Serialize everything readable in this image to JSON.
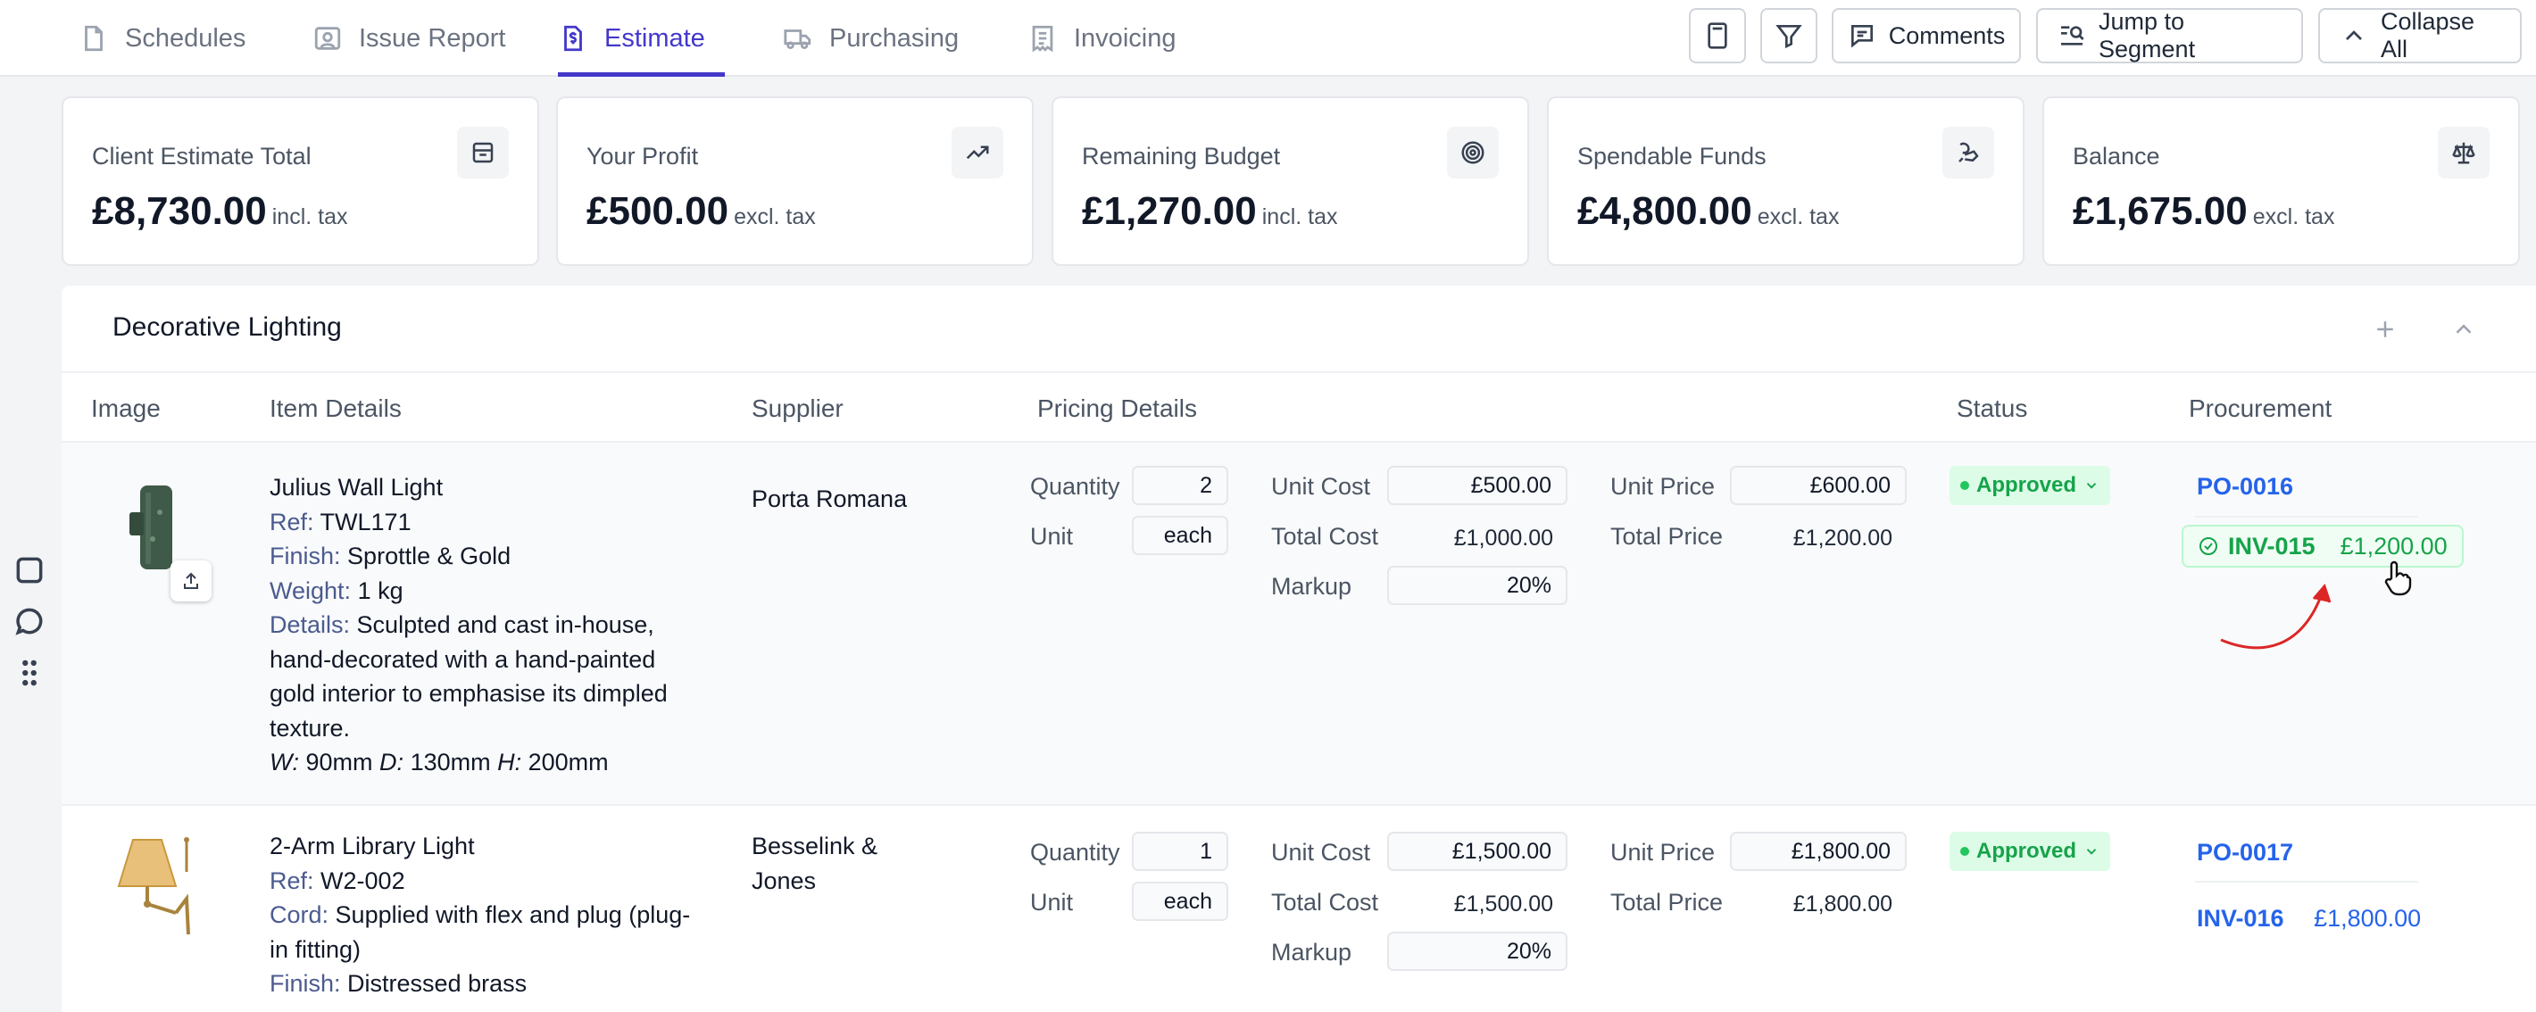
{
  "tabs": [
    {
      "label": "Schedules",
      "icon": "schedules-icon",
      "active": false
    },
    {
      "label": "Issue Report",
      "icon": "issue-report-icon",
      "active": false
    },
    {
      "label": "Estimate",
      "icon": "estimate-icon",
      "active": true
    },
    {
      "label": "Purchasing",
      "icon": "truck-icon",
      "active": false
    },
    {
      "label": "Invoicing",
      "icon": "invoice-icon",
      "active": false
    }
  ],
  "toolbar": {
    "comments_label": "Comments",
    "jump_label": "Jump to Segment",
    "collapse_label": "Collapse All"
  },
  "summary_cards": [
    {
      "label": "Client Estimate Total",
      "amount": "£8,730.00",
      "tax": "incl. tax",
      "icon": "inbox-icon"
    },
    {
      "label": "Your Profit",
      "amount": "£500.00",
      "tax": "excl. tax",
      "icon": "trending-up-icon"
    },
    {
      "label": "Remaining Budget",
      "amount": "£1,270.00",
      "tax": "incl. tax",
      "icon": "target-icon"
    },
    {
      "label": "Spendable Funds",
      "amount": "£4,800.00",
      "tax": "excl. tax",
      "icon": "coins-icon"
    },
    {
      "label": "Balance",
      "amount": "£1,675.00",
      "tax": "excl. tax",
      "icon": "scale-icon"
    }
  ],
  "section": {
    "title": "Decorative Lighting",
    "columns": [
      "Image",
      "Item Details",
      "Supplier",
      "Pricing Details",
      "Status",
      "Procurement"
    ]
  },
  "labels": {
    "ref": "Ref:",
    "finish": "Finish:",
    "weight": "Weight:",
    "details": "Details:",
    "cord": "Cord:",
    "w": "W:",
    "d": "D:",
    "h": "H:",
    "quantity": "Quantity",
    "unit": "Unit",
    "unit_cost": "Unit Cost",
    "total_cost": "Total Cost",
    "markup": "Markup",
    "unit_price": "Unit Price",
    "total_price": "Total Price",
    "percent": "%"
  },
  "items": [
    {
      "name": "Julius Wall Light",
      "ref": "TWL171",
      "finish": "Sprottle & Gold",
      "weight": "1 kg",
      "details": "Sculpted and cast in-house, hand-decorated with a hand-painted gold interior to emphasise its dimpled texture.",
      "w": "90mm",
      "d": "130mm",
      "h": "200mm",
      "supplier": "Porta Romana",
      "quantity": "2",
      "unit": "each",
      "unit_cost": "£500.00",
      "total_cost": "£1,000.00",
      "markup": "20",
      "unit_price": "£600.00",
      "total_price": "£1,200.00",
      "status": "Approved",
      "po": "PO-0016",
      "invoice": "INV-015",
      "invoice_amount": "£1,200.00"
    },
    {
      "name": "2-Arm Library Light",
      "ref": "W2-002",
      "cord": "Supplied with flex and plug (plug-in fitting)",
      "finish": "Distressed brass",
      "supplier": "Besselink & Jones",
      "quantity": "1",
      "unit": "each",
      "unit_cost": "£1,500.00",
      "total_cost": "£1,500.00",
      "markup": "20",
      "unit_price": "£1,800.00",
      "total_price": "£1,800.00",
      "status": "Approved",
      "po": "PO-0017",
      "invoice": "INV-016",
      "invoice_amount": "£1,800.00"
    }
  ],
  "colors": {
    "accent": "#4338ca",
    "approved_bg": "#dcfce7",
    "approved_text": "#16a34a",
    "link": "#2563eb",
    "annotation_arrow": "#dc2626"
  }
}
